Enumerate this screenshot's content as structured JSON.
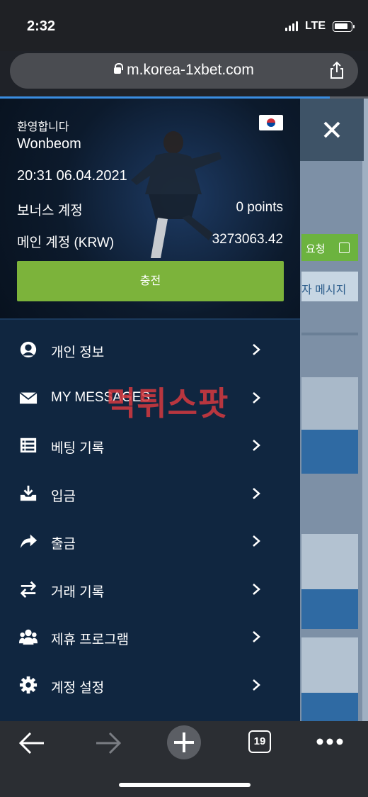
{
  "status_bar": {
    "time": "2:32",
    "network": "LTE"
  },
  "browser": {
    "url": "m.korea-1xbet.com",
    "tab_count": "19"
  },
  "drawer": {
    "welcome": "환영합니다",
    "username": "Wonbeom",
    "datetime": "20:31 06.04.2021",
    "bonus_label": "보너스 계정",
    "bonus_value": "0 points",
    "main_label": "메인 계정 (KRW)",
    "main_value": "3273063.42",
    "charge_button": "충전",
    "menu": [
      {
        "label": "개인 정보",
        "icon": "user-icon"
      },
      {
        "label": "MY MESSAGES",
        "icon": "envelope-icon"
      },
      {
        "label": "베팅 기록",
        "icon": "list-icon"
      },
      {
        "label": "입금",
        "icon": "deposit-icon"
      },
      {
        "label": "출금",
        "icon": "share-arrow-icon"
      },
      {
        "label": "거래 기록",
        "icon": "transfer-icon"
      },
      {
        "label": "제휴 프로그램",
        "icon": "people-icon"
      },
      {
        "label": "계정 설정",
        "icon": "gear-icon"
      }
    ]
  },
  "background_site": {
    "request_button": "요청",
    "message_button": "자 메시지"
  },
  "watermark": "먹튀스팟",
  "colors": {
    "drawer_bg": "#102640",
    "charge_green": "#7cb33b",
    "accent_blue": "#3a8de0"
  }
}
